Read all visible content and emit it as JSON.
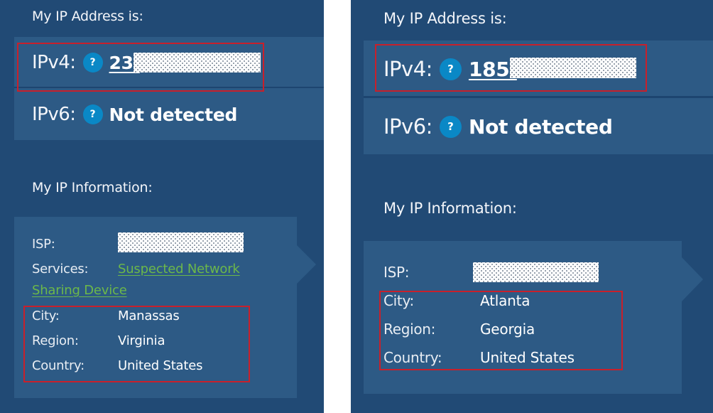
{
  "panels": [
    {
      "address_heading": "My IP Address is:",
      "ipv4": {
        "label": "IPv4:",
        "help": "?",
        "value_prefix": "23.",
        "value_redacted": true
      },
      "ipv6": {
        "label": "IPv6:",
        "help": "?",
        "value": "Not detected"
      },
      "info_heading": "My IP Information:",
      "info": {
        "isp": {
          "label": "ISP:",
          "value_redacted": true
        },
        "services": {
          "label": "Services:",
          "value_line1": "Suspected Network",
          "value_line2": "Sharing Device"
        },
        "city": {
          "label": "City:",
          "value": "Manassas"
        },
        "region": {
          "label": "Region:",
          "value": "Virginia"
        },
        "country": {
          "label": "Country:",
          "value": "United States"
        }
      }
    },
    {
      "address_heading": "My IP Address is:",
      "ipv4": {
        "label": "IPv4:",
        "help": "?",
        "value_prefix": "185.",
        "value_redacted": true
      },
      "ipv6": {
        "label": "IPv6:",
        "help": "?",
        "value": "Not detected"
      },
      "info_heading": "My IP Information:",
      "info": {
        "isp": {
          "label": "ISP:",
          "value_redacted": true
        },
        "city": {
          "label": "City:",
          "value": "Atlanta"
        },
        "region": {
          "label": "Region:",
          "value": "Georgia"
        },
        "country": {
          "label": "Country:",
          "value": "United States"
        }
      }
    }
  ],
  "colors": {
    "panel_bg": "#214a75",
    "row_bg": "#2d5a85",
    "help_icon": "#0a88c6",
    "link_green": "#6cb84a",
    "highlight_box": "#c8202b"
  }
}
